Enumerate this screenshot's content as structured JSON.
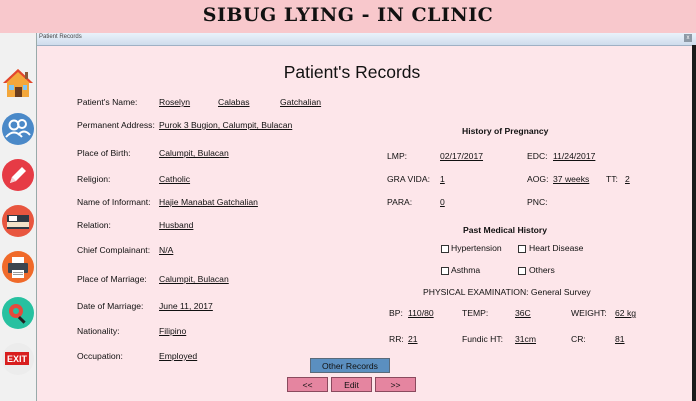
{
  "app": {
    "title": "SIBUG LYING - IN CLINIC"
  },
  "sidebar": {
    "items": [
      {
        "name": "home-icon"
      },
      {
        "name": "patients-icon"
      },
      {
        "name": "pencil-icon"
      },
      {
        "name": "bed-icon"
      },
      {
        "name": "printer-icon"
      },
      {
        "name": "settings-search-icon"
      },
      {
        "name": "exit-icon",
        "label": "EXIT"
      }
    ]
  },
  "window": {
    "title": "Patient Records",
    "close_label": "x"
  },
  "page": {
    "title": "Patient's Records"
  },
  "patient": {
    "name_label": "Patient's Name:",
    "first_name": "Roselyn",
    "middle_name": "Calabas",
    "last_name": "Gatchalian",
    "address_label": "Permanent Address:",
    "address": "Purok 3 Bugion, Calumpit, Bulacan",
    "birthplace_label": "Place of Birth:",
    "birthplace": "Calumpit, Bulacan",
    "religion_label": "Religion:",
    "religion": "Catholic",
    "informant_label": "Name of Informant:",
    "informant": "Hajie Manabat Gatchalian",
    "relation_label": "Relation:",
    "relation": "Husband",
    "complainant_label": "Chief Complainant:",
    "complainant": "N/A",
    "marriage_place_label": "Place of Marriage:",
    "marriage_place": "Calumpit, Bulacan",
    "marriage_date_label": "Date of Marriage:",
    "marriage_date": "June 11, 2017",
    "nationality_label": "Nationality:",
    "nationality": "Filipino",
    "occupation_label": "Occupation:",
    "occupation": "Employed"
  },
  "pregnancy": {
    "heading": "History of Pregnancy",
    "lmp_label": "LMP:",
    "lmp": "02/17/2017",
    "edc_label": "EDC:",
    "edc": "11/24/2017",
    "gravida_label": "GRA VIDA:",
    "gravida": "1",
    "aog_label": "AOG:",
    "aog": "37 weeks",
    "tt_label": "TT:",
    "tt": "2",
    "para_label": "PARA:",
    "para": "0",
    "pnc_label": "PNC:",
    "pnc": ""
  },
  "medical_history": {
    "heading": "Past Medical History",
    "hypertension": "Hypertension",
    "heart_disease": "Heart Disease",
    "asthma": "Asthma",
    "others": "Others"
  },
  "exam": {
    "heading": "PHYSICAL EXAMINATION: General Survey",
    "bp_label": "BP:",
    "bp": "110/80",
    "temp_label": "TEMP:",
    "temp": "36C",
    "weight_label": "WEIGHT:",
    "weight": "62 kg",
    "rr_label": "RR:",
    "rr": "21",
    "fundic_label": "Fundic HT:",
    "fundic": "31cm",
    "cr_label": "CR:",
    "cr": "81"
  },
  "actions": {
    "other_records": "Other Records",
    "prev": "<<",
    "edit": "Edit",
    "next": ">>"
  },
  "colors": {
    "header_bg": "#f8c8cc",
    "content_bg": "#fde6ea",
    "button_blue": "#5b8fc0",
    "button_pink": "#e585a0"
  }
}
